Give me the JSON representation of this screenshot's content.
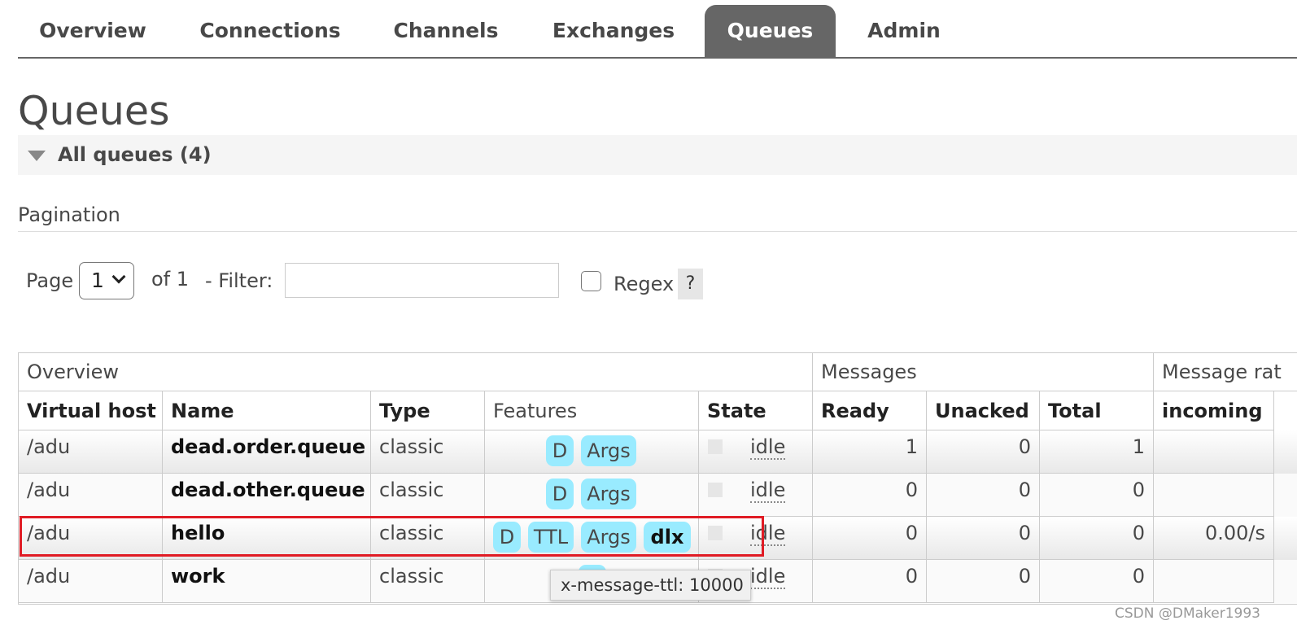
{
  "nav": {
    "tabs": [
      {
        "label": "Overview",
        "active": false
      },
      {
        "label": "Connections",
        "active": false
      },
      {
        "label": "Channels",
        "active": false
      },
      {
        "label": "Exchanges",
        "active": false
      },
      {
        "label": "Queues",
        "active": true
      },
      {
        "label": "Admin",
        "active": false
      }
    ]
  },
  "page": {
    "title": "Queues",
    "section_title": "All queues (4)",
    "section_icon": "triangle-down-icon"
  },
  "pagination": {
    "label": "Pagination",
    "page_label": "Page",
    "page_value": "1",
    "of_label": "of 1",
    "filter_label": "- Filter:",
    "filter_value": "",
    "regex_label": "Regex",
    "regex_checked": false,
    "help_label": "?"
  },
  "table": {
    "groups": [
      "Overview",
      "Messages",
      "Message rat"
    ],
    "headers": [
      "Virtual host",
      "Name",
      "Type",
      "Features",
      "State",
      "Ready",
      "Unacked",
      "Total",
      "incoming"
    ],
    "rows": [
      {
        "vhost": "/adu",
        "name": "dead.order.queue",
        "type": "classic",
        "features": [
          "D",
          "Args"
        ],
        "state": "idle",
        "ready": "1",
        "unacked": "0",
        "total": "1",
        "incoming": ""
      },
      {
        "vhost": "/adu",
        "name": "dead.other.queue",
        "type": "classic",
        "features": [
          "D",
          "Args"
        ],
        "state": "idle",
        "ready": "0",
        "unacked": "0",
        "total": "0",
        "incoming": ""
      },
      {
        "vhost": "/adu",
        "name": "hello",
        "type": "classic",
        "features": [
          "D",
          "TTL",
          "Args",
          "dlx"
        ],
        "state": "idle",
        "ready": "0",
        "unacked": "0",
        "total": "0",
        "incoming": "0.00/s"
      },
      {
        "vhost": "/adu",
        "name": "work",
        "type": "classic",
        "features": [],
        "state": "idle",
        "ready": "0",
        "unacked": "0",
        "total": "0",
        "incoming": ""
      }
    ]
  },
  "tooltip": {
    "text": "x-message-ttl: 10000"
  },
  "colors": {
    "badge": "#99ebff",
    "active_tab": "#666666",
    "highlight": "#e01b24"
  },
  "watermark": "CSDN @DMaker1993"
}
